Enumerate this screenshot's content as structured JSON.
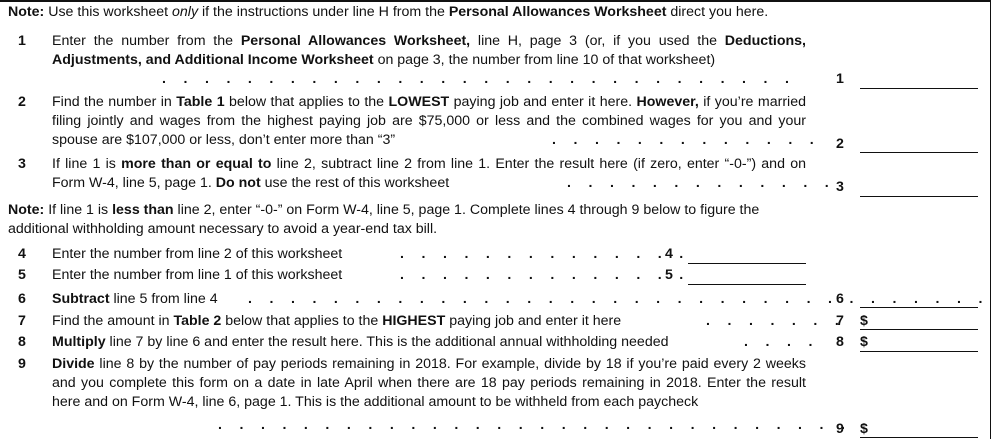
{
  "note1": {
    "label": "Note:",
    "t1": "Use this worksheet ",
    "only": "only",
    "t2": " if the instructions under line H from the ",
    "ws": "Personal Allowances Worksheet",
    "t3": " direct you here."
  },
  "line1": {
    "number": "1",
    "t1": "Enter the number from the ",
    "b1": "Personal Allowances Worksheet,",
    "t2": " line H, page 3 (or, if you used the ",
    "b2": "Deductions, Adjustments, and Additional Income Worksheet",
    "t3": " on page 3, the number from line 10 of that worksheet)",
    "dots": ". . . . . . . . . . . . . . . . . . . . . . . . . . . . . .",
    "entry": "1"
  },
  "line2": {
    "number": "2",
    "t1": "Find the number in ",
    "b1": "Table 1",
    "t2": " below that applies to the ",
    "b2": "LOWEST",
    "t3": " paying job and enter it here. ",
    "b3": "However,",
    "t4": " if you’re married filing jointly and wages from the highest paying job are $75,000 or less and the combined wages for you and your spouse are $107,000 or less, don’t enter more than “3” ",
    "dots": ". . . . . . . . . . . . .",
    "entry": "2"
  },
  "line3": {
    "number": "3",
    "t1": "If line 1 is ",
    "b1": "more than or equal to",
    "t2": " line 2, subtract line 2 from line 1. Enter the result here (if zero, enter “-0-”) and on Form W-4, line 5, page 1. ",
    "b2": "Do not",
    "t3": " use the rest of this worksheet ",
    "dots": ". . . . . . . . . . . . .",
    "entry": "3"
  },
  "note2": {
    "label": "Note:",
    "t1": " If line 1 is ",
    "b1": "less than",
    "t2": " line 2, enter “-0-” on Form W-4, line 5, page 1. Complete lines 4 through 9 below to figure the additional withholding amount necessary to avoid a year-end tax bill."
  },
  "line4": {
    "number": "4",
    "text": "Enter the number from line 2 of this worksheet",
    "dots": ". . . . . . . . . . . . . .",
    "entry": "4"
  },
  "line5": {
    "number": "5",
    "text": "Enter the number from line 1 of this worksheet",
    "dots": ". . . . . . . . . . . . . .",
    "entry": "5"
  },
  "line6": {
    "number": "6",
    "b1": "Subtract",
    "t1": " line 5 from line 4 ",
    "dots": ". . . . . . . . . . . . . . . . . . . . . . . . . . . . . . . . . . .",
    "entry": "6"
  },
  "line7": {
    "number": "7",
    "t1": "Find the amount in ",
    "b1": "Table 2",
    "t2": " below that applies to the ",
    "b2": "HIGHEST",
    "t3": " paying job and enter it here",
    "dots": ". . . . . . .",
    "entry": "7",
    "currency": "$"
  },
  "line8": {
    "number": "8",
    "b1": "Multiply",
    "t1": " line 7 by line 6 and enter the result here. This is the additional annual withholding needed",
    "dots": ". . . .",
    "entry": "8",
    "currency": "$"
  },
  "line9": {
    "number": "9",
    "b1": "Divide",
    "t1": " line 8 by the number of pay periods remaining in 2018. For example, divide by 18 if you’re paid every 2 weeks and you complete this form on a date in late April when there are 18 pay periods remaining in 2018. Enter the result here and on Form W-4, line 6, page 1. This is the additional amount to be withheld from each paycheck",
    "dots": ". . . . . . . . . . . . . . . . . . . . . . . . . . . . . .",
    "entry": "9",
    "currency": "$"
  }
}
